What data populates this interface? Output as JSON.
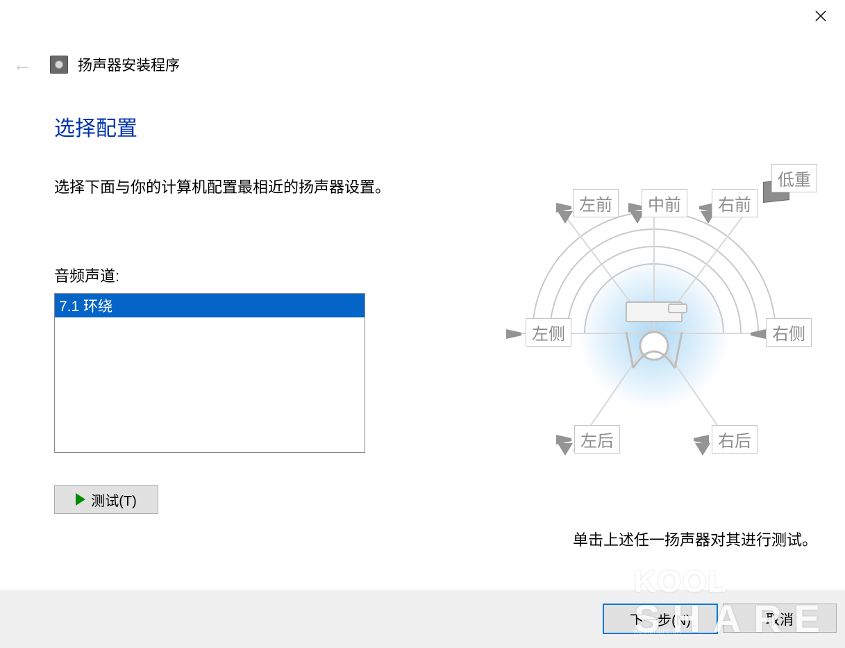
{
  "window": {
    "title": "扬声器安装程序"
  },
  "heading": "选择配置",
  "instruction": "选择下面与你的计算机配置最相近的扬声器设置。",
  "list": {
    "label": "音频声道:",
    "items": [
      "7.1 环绕"
    ],
    "selected_index": 0
  },
  "buttons": {
    "test": "测试(T)",
    "next": "下一步(N)",
    "cancel": "取消"
  },
  "diagram": {
    "hint": "单击上述任一扬声器对其进行测试。",
    "speakers": {
      "front_left": "左前",
      "front_center": "中前",
      "front_right": "右前",
      "subwoofer": "低重",
      "side_left": "左侧",
      "side_right": "右侧",
      "rear_left": "左后",
      "rear_right": "右后"
    }
  },
  "watermark": {
    "brand_top": "KOOL",
    "brand_bottom": "SHARE",
    "url": "koolshare.cn"
  }
}
